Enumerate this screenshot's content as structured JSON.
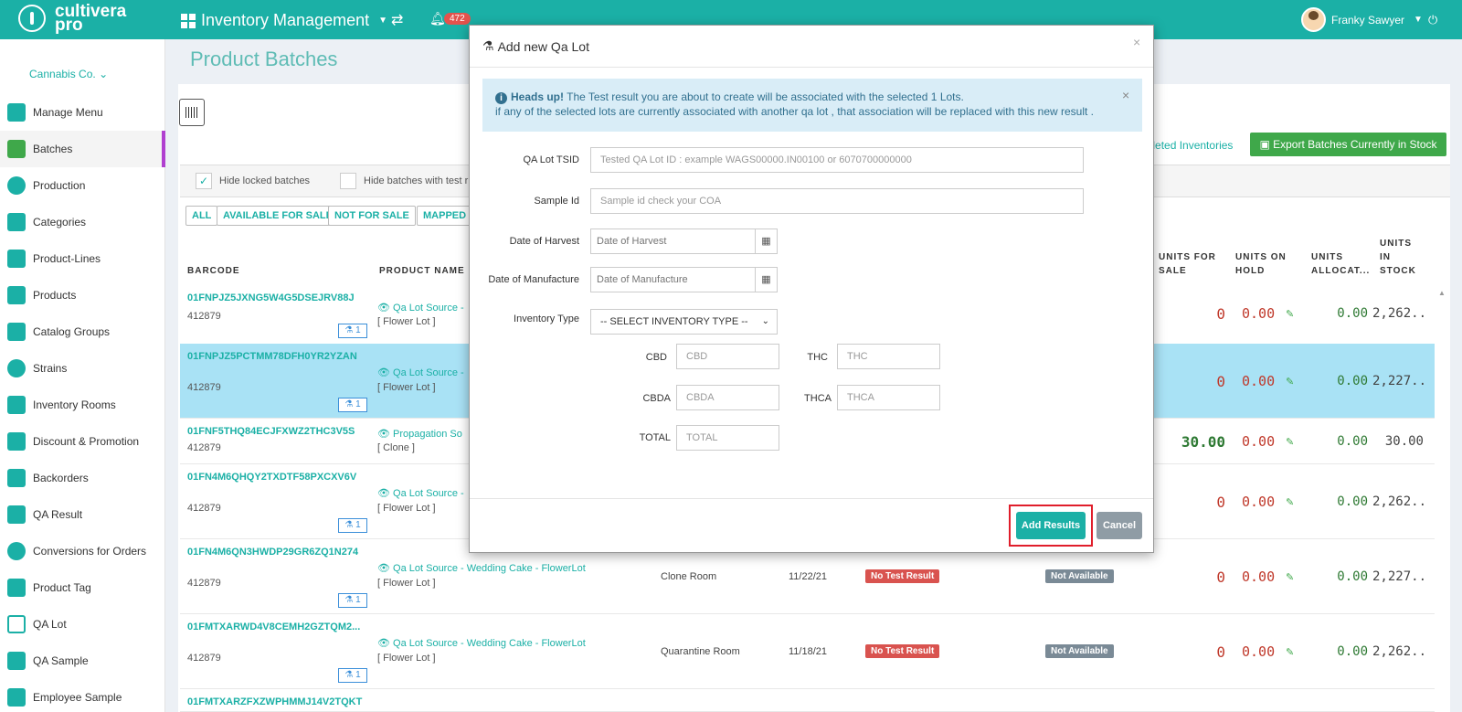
{
  "topbar": {
    "logo_line1": "cultivera",
    "logo_line2": "pro",
    "app_title": "Inventory Management",
    "notification_count": "472",
    "user_name": "Franky Sawyer"
  },
  "sidebar": {
    "company": "Cannabis Co.",
    "items": [
      {
        "label": "Manage Menu"
      },
      {
        "label": "Batches"
      },
      {
        "label": "Production"
      },
      {
        "label": "Categories"
      },
      {
        "label": "Product-Lines"
      },
      {
        "label": "Products"
      },
      {
        "label": "Catalog Groups"
      },
      {
        "label": "Strains"
      },
      {
        "label": "Inventory Rooms"
      },
      {
        "label": "Discount & Promotion"
      },
      {
        "label": "Backorders"
      },
      {
        "label": "QA Result"
      },
      {
        "label": "Conversions for Orders"
      },
      {
        "label": "Product Tag"
      },
      {
        "label": "QA Lot"
      },
      {
        "label": "QA Sample"
      },
      {
        "label": "Employee Sample"
      }
    ]
  },
  "page": {
    "title": "Product Batches",
    "hide_locked": "Hide locked batches",
    "hide_test": "Hide batches with test r",
    "filters": [
      "ALL",
      "AVAILABLE FOR SALE",
      "NOT FOR SALE",
      "MAPPED"
    ],
    "depleted_link": "epleted Inventories",
    "export_button": "Export Batches Currently in Stock"
  },
  "table": {
    "headers": {
      "barcode": "BARCODE",
      "product_name": "PRODUCT NAME",
      "units_for_sale": "UNITS FOR SALE",
      "units_on_hold": "UNITS ON HOLD",
      "units_allocated": "UNITS ALLOCAT...",
      "units_in_stock": "UNITS IN STOCK"
    },
    "rows": [
      {
        "barcode": "01FNPJZ5JXNG5W4G5DSEJRV88J",
        "num": "412879",
        "qa": "1",
        "product": "Qa Lot Source -",
        "type": "[ Flower Lot ]",
        "room": "",
        "date": "",
        "test": "",
        "avail": "",
        "for_sale": "0",
        "hold": "0.00",
        "alloc": "0.00",
        "stock": "2,262...."
      },
      {
        "barcode": "01FNPJZ5PCTMM78DFH0YR2YZAN",
        "num": "412879",
        "qa": "1",
        "product": "Qa Lot Source -",
        "type": "[ Flower Lot ]",
        "room": "",
        "date": "",
        "test": "",
        "avail": "",
        "for_sale": "0",
        "hold": "0.00",
        "alloc": "0.00",
        "stock": "2,227...."
      },
      {
        "barcode": "01FNF5THQ84ECJFXWZ2THC3V5S",
        "num": "412879",
        "qa": "",
        "product": "Propagation So",
        "type": "[ Clone ]",
        "room": "",
        "date": "",
        "test": "",
        "avail": "",
        "for_sale": "30.00",
        "hold": "0.00",
        "alloc": "0.00",
        "stock": "30.00"
      },
      {
        "barcode": "01FN4M6QHQY2TXDTF58PXCXV6V",
        "num": "412879",
        "qa": "1",
        "product": "Qa Lot Source -",
        "type": "[ Flower Lot ]",
        "room": "",
        "date": "",
        "test": "",
        "avail": "",
        "for_sale": "0",
        "hold": "0.00",
        "alloc": "0.00",
        "stock": "2,262...."
      },
      {
        "barcode": "01FN4M6QN3HWDP29GR6ZQ1N274",
        "num": "412879",
        "qa": "1",
        "product": "Qa Lot Source - Wedding Cake - FlowerLot",
        "type": "[ Flower Lot ]",
        "room": "Clone Room",
        "date": "11/22/21",
        "test": "No Test Result",
        "avail": "Not Available",
        "for_sale": "0",
        "hold": "0.00",
        "alloc": "0.00",
        "stock": "2,227...."
      },
      {
        "barcode": "01FMTXARWD4V8CEMH2GZTQM2...",
        "num": "412879",
        "qa": "1",
        "product": "Qa Lot Source - Wedding Cake - FlowerLot",
        "type": "[ Flower Lot ]",
        "room": "Quarantine Room",
        "date": "11/18/21",
        "test": "No Test Result",
        "avail": "Not Available",
        "for_sale": "0",
        "hold": "0.00",
        "alloc": "0.00",
        "stock": "2,262...."
      },
      {
        "barcode": "01FMTXARZFXZWPHMMJ14V2TQKT",
        "num": "",
        "qa": "",
        "product": "",
        "type": "",
        "room": "",
        "date": "",
        "test": "",
        "avail": "",
        "for_sale": "",
        "hold": "",
        "alloc": "",
        "stock": ""
      }
    ]
  },
  "modal": {
    "title": "Add new Qa Lot",
    "alert_heading": "Heads up!",
    "alert_line1": "The Test result you are about to create will be associated with the selected 1 Lots.",
    "alert_line2": "if any of the selected lots are currently associated with another qa lot , that association will be replaced with this new result .",
    "fields": {
      "qa_lot_tsid_label": "QA Lot TSID",
      "qa_lot_tsid_placeholder": "Tested QA Lot ID : example WAGS00000.IN00100 or 6070700000000",
      "sample_id_label": "Sample Id",
      "sample_id_placeholder": "Sample id check your COA",
      "harvest_label": "Date of Harvest",
      "harvest_placeholder": "Date of Harvest",
      "manufacture_label": "Date of Manufacture",
      "manufacture_placeholder": "Date of Manufacture",
      "inventory_type_label": "Inventory Type",
      "inventory_type_value": "-- SELECT INVENTORY TYPE --",
      "cbd_label": "CBD",
      "cbd_placeholder": "CBD",
      "thc_label": "THC",
      "thc_placeholder": "THC",
      "cbda_label": "CBDA",
      "cbda_placeholder": "CBDA",
      "thca_label": "THCA",
      "thca_placeholder": "THCA",
      "total_label": "TOTAL",
      "total_placeholder": "TOTAL"
    },
    "add_button": "Add Results",
    "cancel_button": "Cancel"
  }
}
